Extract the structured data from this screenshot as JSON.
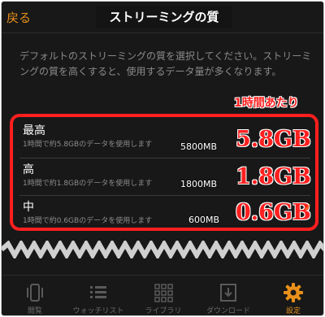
{
  "header": {
    "back_label": "戻る",
    "title": "ストリーミングの質"
  },
  "description": "デフォルトのストリーミングの質を選択してください。ストリーミングの質を高くすると、使用するデータ量が多くなります。",
  "annotation": "1時間あたり",
  "options": [
    {
      "title": "最高",
      "subtitle": "1時間で約5.8GBのデータを使用します",
      "mb": "5800MB",
      "gb": "5.8GB",
      "selected": false
    },
    {
      "title": "高",
      "subtitle": "1時間で約1.8GBのデータを使用します",
      "mb": "1800MB",
      "gb": "1.8GB",
      "selected": false
    },
    {
      "title": "中",
      "subtitle": "1時間で約0.6GBのデータを使用します",
      "mb": "600MB",
      "gb": "0.6GB",
      "selected": true
    }
  ],
  "tabs": [
    {
      "label": "閲覧",
      "icon": "phone-icon",
      "active": false
    },
    {
      "label": "ウォッチリスト",
      "icon": "list-icon",
      "active": false
    },
    {
      "label": "ライブラリ",
      "icon": "grid-icon",
      "active": false
    },
    {
      "label": "ダウンロード",
      "icon": "download-icon",
      "active": false
    },
    {
      "label": "設定",
      "icon": "gear-icon",
      "active": true
    }
  ],
  "colors": {
    "accent": "#e8901a",
    "highlight": "#ff1f1f",
    "background": "#181818"
  }
}
